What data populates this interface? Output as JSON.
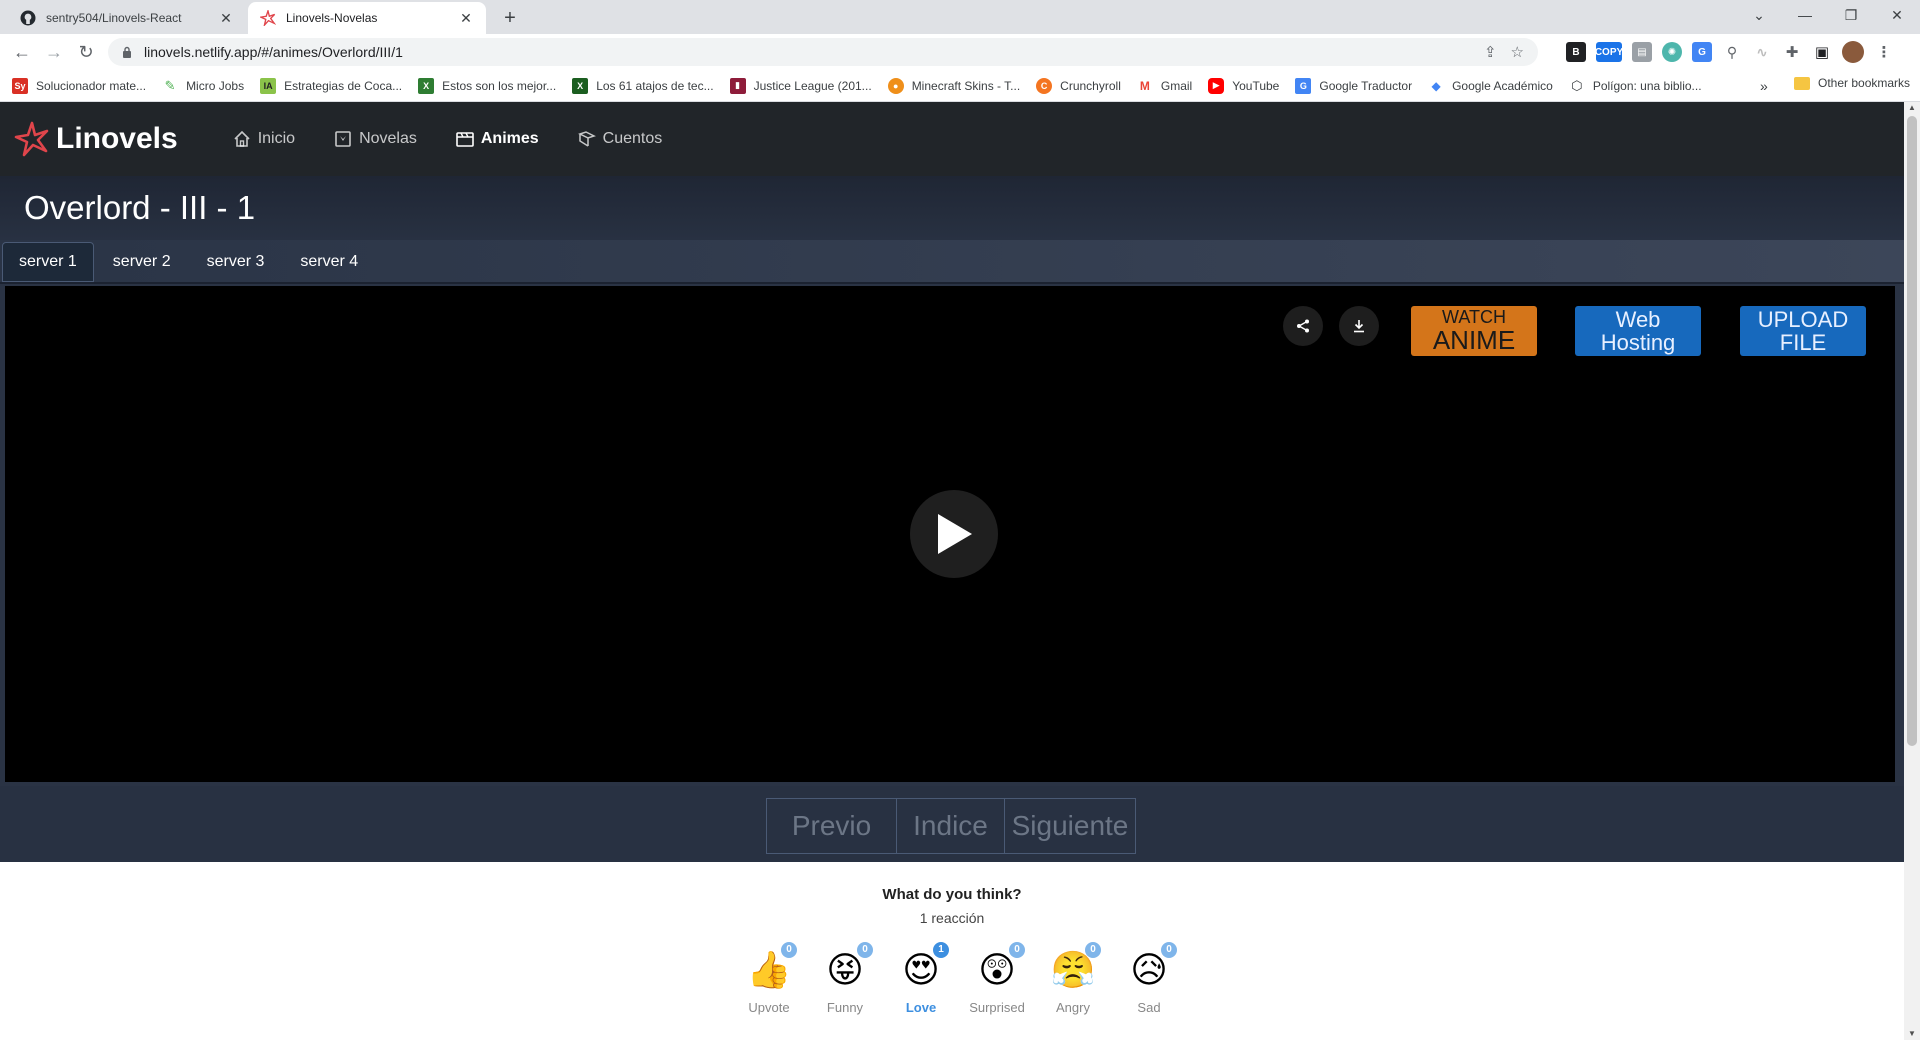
{
  "browser": {
    "tabs": [
      {
        "title": "sentry504/Linovels-React",
        "active": false
      },
      {
        "title": "Linovels-Novelas",
        "active": true
      }
    ],
    "url": "linovels.netlify.app/#/animes/Overlord/III/1",
    "bookmarks": [
      {
        "label": "Solucionador mate...",
        "icon": "sy-icon",
        "color": "#d93025"
      },
      {
        "label": "Micro Jobs",
        "icon": "leaf-icon",
        "color": "#4caf50"
      },
      {
        "label": "Estrategias de Coca...",
        "icon": "ia-icon",
        "color": "#8bc34a"
      },
      {
        "label": "Estos son los mejor...",
        "icon": "x-icon",
        "color": "#2e7d32"
      },
      {
        "label": "Los 61 atajos de tec...",
        "icon": "x-icon",
        "color": "#1b5e20"
      },
      {
        "label": "Justice League (201...",
        "icon": "film-icon",
        "color": "#8e1c3a"
      },
      {
        "label": "Minecraft Skins - T...",
        "icon": "pumpkin-icon",
        "color": "#ef8f1a"
      },
      {
        "label": "Crunchyroll",
        "icon": "crunchyroll-icon",
        "color": "#f47521"
      },
      {
        "label": "Gmail",
        "icon": "gmail-icon",
        "color": "#ea4335"
      },
      {
        "label": "YouTube",
        "icon": "youtube-icon",
        "color": "#ff0000"
      },
      {
        "label": "Google Traductor",
        "icon": "translate-icon",
        "color": "#4285f4"
      },
      {
        "label": "Google Académico",
        "icon": "scholar-icon",
        "color": "#4285f4"
      },
      {
        "label": "Polígon: una biblio...",
        "icon": "polygon-icon",
        "color": "#3c4043"
      }
    ],
    "other_bookmarks": "Other bookmarks"
  },
  "site": {
    "brand": "Linovels",
    "nav": [
      {
        "label": "Inicio",
        "icon": "home-icon",
        "active": false
      },
      {
        "label": "Novelas",
        "icon": "book-icon",
        "active": false
      },
      {
        "label": "Animes",
        "icon": "film-icon",
        "active": true
      },
      {
        "label": "Cuentos",
        "icon": "story-icon",
        "active": false
      }
    ],
    "page_title": "Overlord - III - 1",
    "servers": [
      "server 1",
      "server 2",
      "server 3",
      "server 4"
    ],
    "active_server": "server 1"
  },
  "player": {
    "ads": {
      "watch_small": "WATCH",
      "watch_big": "ANIME",
      "web": "Web Hosting",
      "upload": "UPLOAD FILE"
    }
  },
  "pager": {
    "prev": "Previo",
    "index": "Indice",
    "next": "Siguiente"
  },
  "reactions": {
    "question": "What do you think?",
    "count_text": "1 reacción",
    "items": [
      {
        "label": "Upvote",
        "count": "0",
        "emoji": "👍",
        "selected": false
      },
      {
        "label": "Funny",
        "count": "0",
        "emoji": "😝",
        "selected": false
      },
      {
        "label": "Love",
        "count": "1",
        "emoji": "😍",
        "selected": true
      },
      {
        "label": "Surprised",
        "count": "0",
        "emoji": "😲",
        "selected": false
      },
      {
        "label": "Angry",
        "count": "0",
        "emoji": "😤",
        "selected": false
      },
      {
        "label": "Sad",
        "count": "0",
        "emoji": "😥",
        "selected": false
      }
    ]
  },
  "colors": {
    "nav_bg": "#212529",
    "accent_blue": "#3d8fe0",
    "watch_ad": "#d4751a",
    "hosting_ad": "#1769bd"
  }
}
